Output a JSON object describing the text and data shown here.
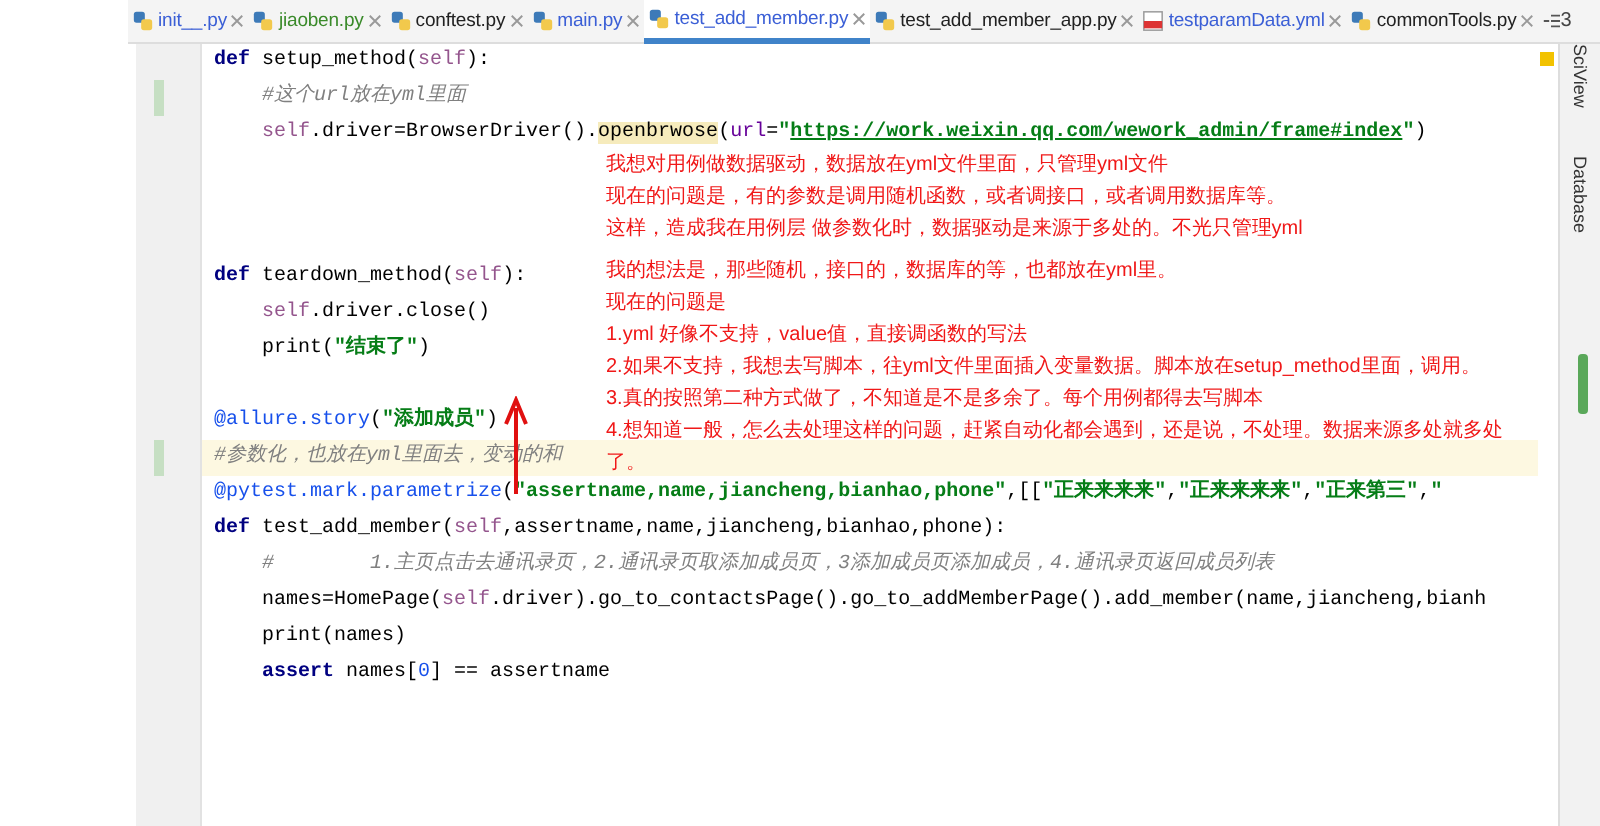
{
  "tabs": [
    {
      "label": "init__.py",
      "color": "#3b5fd6",
      "selected": false
    },
    {
      "label": "jiaoben.py",
      "color": "#3a8a2a",
      "selected": false
    },
    {
      "label": "conftest.py",
      "color": "#222222",
      "selected": false
    },
    {
      "label": "main.py",
      "color": "#3b5fd6",
      "selected": false
    },
    {
      "label": "test_add_member.py",
      "color": "#3b5fd6",
      "selected": true
    },
    {
      "label": "test_add_member_app.py",
      "color": "#222222",
      "selected": false
    },
    {
      "label": "testparamData.yml",
      "color": "#3b5fd6",
      "selected": false
    },
    {
      "label": "commonTools.py",
      "color": "#222222",
      "selected": false
    }
  ],
  "tab_overflow": {
    "count": "3"
  },
  "code_lines": [
    {
      "kind": "code",
      "changed": false,
      "highlighted": false,
      "segments": [
        {
          "kind": "keyword",
          "text": "def"
        },
        {
          "kind": "plain",
          "text": " setup_method("
        },
        {
          "kind": "self",
          "text": "self"
        },
        {
          "kind": "plain",
          "text": "):"
        }
      ]
    },
    {
      "kind": "code",
      "changed": true,
      "highlighted": false,
      "segments": [
        {
          "kind": "comment",
          "text": "    #这个url放在yml里面"
        }
      ]
    },
    {
      "kind": "code",
      "changed": false,
      "highlighted": false,
      "segments": [
        {
          "kind": "self",
          "text": "    self"
        },
        {
          "kind": "plain",
          "text": ".driver=BrowserDriver()."
        },
        {
          "kind": "match",
          "text": "openbrwose"
        },
        {
          "kind": "plain",
          "text": "("
        },
        {
          "kind": "param",
          "text": "url"
        },
        {
          "kind": "plain",
          "text": "="
        },
        {
          "kind": "string",
          "text": "\""
        },
        {
          "kind": "url",
          "text": "https://work.weixin.qq.com/wework_admin/frame#index"
        },
        {
          "kind": "string",
          "text": "\""
        },
        {
          "kind": "plain",
          "text": ")"
        }
      ]
    },
    {
      "kind": "blank"
    },
    {
      "kind": "blank"
    },
    {
      "kind": "blank"
    },
    {
      "kind": "code",
      "changed": false,
      "highlighted": false,
      "segments": [
        {
          "kind": "keyword",
          "text": "def"
        },
        {
          "kind": "plain",
          "text": " teardown_method("
        },
        {
          "kind": "self",
          "text": "self"
        },
        {
          "kind": "plain",
          "text": "):"
        }
      ]
    },
    {
      "kind": "code",
      "changed": false,
      "highlighted": false,
      "segments": [
        {
          "kind": "self",
          "text": "    self"
        },
        {
          "kind": "plain",
          "text": ".driver.close()"
        }
      ]
    },
    {
      "kind": "code",
      "changed": false,
      "highlighted": false,
      "segments": [
        {
          "kind": "plain",
          "text": "    print("
        },
        {
          "kind": "string",
          "text": "\"结束了\""
        },
        {
          "kind": "plain",
          "text": ")"
        }
      ]
    },
    {
      "kind": "blank"
    },
    {
      "kind": "code",
      "changed": false,
      "highlighted": false,
      "segments": [
        {
          "kind": "decorator",
          "text": "@allure.story"
        },
        {
          "kind": "plain",
          "text": "("
        },
        {
          "kind": "string",
          "text": "\"添加成员\""
        },
        {
          "kind": "plain",
          "text": ")"
        }
      ]
    },
    {
      "kind": "code",
      "changed": true,
      "highlighted": true,
      "segments": [
        {
          "kind": "comment",
          "text": "#参数化，也放在yml里面去，变动的和"
        }
      ]
    },
    {
      "kind": "code",
      "changed": false,
      "highlighted": false,
      "segments": [
        {
          "kind": "decorator",
          "text": "@pytest.mark.parametrize"
        },
        {
          "kind": "plain",
          "text": "("
        },
        {
          "kind": "string",
          "text": "\"assertname,name,jiancheng,bianhao,phone\""
        },
        {
          "kind": "plain",
          "text": ",[["
        },
        {
          "kind": "string",
          "text": "\"正来来来来\""
        },
        {
          "kind": "plain",
          "text": ","
        },
        {
          "kind": "string",
          "text": "\"正来来来来\""
        },
        {
          "kind": "plain",
          "text": ","
        },
        {
          "kind": "string",
          "text": "\"正来第三\""
        },
        {
          "kind": "plain",
          "text": ","
        },
        {
          "kind": "string",
          "text": "\""
        }
      ]
    },
    {
      "kind": "code",
      "changed": false,
      "highlighted": false,
      "segments": [
        {
          "kind": "keyword",
          "text": "def"
        },
        {
          "kind": "plain",
          "text": " test_add_member("
        },
        {
          "kind": "self",
          "text": "self"
        },
        {
          "kind": "plain",
          "text": ",assertname,name,jiancheng,bianhao,phone):"
        }
      ]
    },
    {
      "kind": "code",
      "changed": false,
      "highlighted": false,
      "segments": [
        {
          "kind": "comment",
          "text": "    #        1.主页点击去通讯录页，2.通讯录页取添加成员页，3添加成员页添加成员，4.通讯录页返回成员列表"
        }
      ]
    },
    {
      "kind": "code",
      "changed": false,
      "highlighted": false,
      "segments": [
        {
          "kind": "plain",
          "text": "    names=HomePage("
        },
        {
          "kind": "self",
          "text": "self"
        },
        {
          "kind": "plain",
          "text": ".driver).go_to_contactsPage().go_to_addMemberPage().add_member(name,jiancheng,bianh"
        }
      ]
    },
    {
      "kind": "code",
      "changed": false,
      "highlighted": false,
      "segments": [
        {
          "kind": "plain",
          "text": "    print(names)"
        }
      ]
    },
    {
      "kind": "code",
      "changed": false,
      "highlighted": false,
      "segments": [
        {
          "kind": "keyword",
          "text": "    assert"
        },
        {
          "kind": "plain",
          "text": " names["
        },
        {
          "kind": "number",
          "text": "0"
        },
        {
          "kind": "plain",
          "text": "] == assertname"
        }
      ]
    }
  ],
  "notes": [
    {
      "lines": [
        "我想对用例做数据驱动，数据放在yml文件里面，只管理yml文件",
        "现在的问题是，有的参数是调用随机函数，或者调接口，或者调用数据库等。",
        "这样，造成我在用例层 做参数化时，数据驱动是来源于多处的。不光只管理yml"
      ]
    },
    {
      "lines": [
        "我的想法是，那些随机，接口的，数据库的等，也都放在yml里。",
        "现在的问题是",
        "1.yml  好像不支持，value值，直接调函数的写法",
        "2.如果不支持，我想去写脚本，往yml文件里面插入变量数据。脚本放在setup_method里面，调用。",
        "3.真的按照第二种方式做了，不知道是不是多余了。每个用例都得去写脚本",
        "4.想知道一般，怎么去处理这样的问题，赶紧自动化都会遇到，还是说，不处理。数据来源多处就多处",
        "了。"
      ]
    }
  ],
  "side_tools": [
    {
      "label": "SciView"
    },
    {
      "label": "Database"
    }
  ]
}
